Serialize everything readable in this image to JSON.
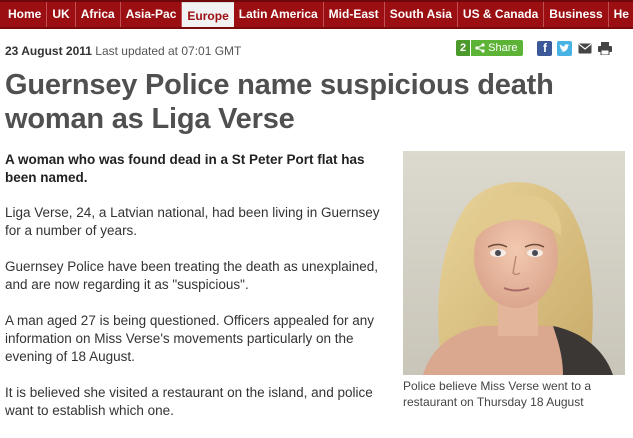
{
  "nav": {
    "items": [
      {
        "label": "Home",
        "active": false
      },
      {
        "label": "UK",
        "active": false
      },
      {
        "label": "Africa",
        "active": false
      },
      {
        "label": "Asia-Pac",
        "active": false
      },
      {
        "label": "Europe",
        "active": true
      },
      {
        "label": "Latin America",
        "active": false
      },
      {
        "label": "Mid-East",
        "active": false
      },
      {
        "label": "South Asia",
        "active": false
      },
      {
        "label": "US & Canada",
        "active": false
      },
      {
        "label": "Business",
        "active": false
      },
      {
        "label": "He",
        "active": false
      }
    ]
  },
  "article": {
    "date": "23 August 2011",
    "updated": "Last updated at 07:01 GMT",
    "headline": "Guernsey Police name suspicious death woman as Liga Verse",
    "intro": "A woman who was found dead in a St Peter Port flat has been named.",
    "paragraphs": [
      "Liga Verse, 24, a Latvian national, had been living in Guernsey for a number of years.",
      "Guernsey Police have been treating the death as unexplained, and are now regarding it as \"suspicious\".",
      "A man aged 27 is being questioned. Officers appealed for any information on Miss Verse's movements particularly on the evening of 18 August.",
      "It is believed she visited a restaurant on the island, and police want to establish which one."
    ],
    "photo_caption": "Police believe Miss Verse went to a restaurant on Thursday 18 August"
  },
  "share": {
    "count": "2",
    "label": "Share",
    "icons": [
      "facebook-icon",
      "twitter-icon",
      "email-icon",
      "print-icon"
    ]
  },
  "colors": {
    "nav_bg": "#9b0f12",
    "share_green": "#5cb336",
    "facebook": "#3b5998",
    "twitter": "#47b3e5"
  }
}
